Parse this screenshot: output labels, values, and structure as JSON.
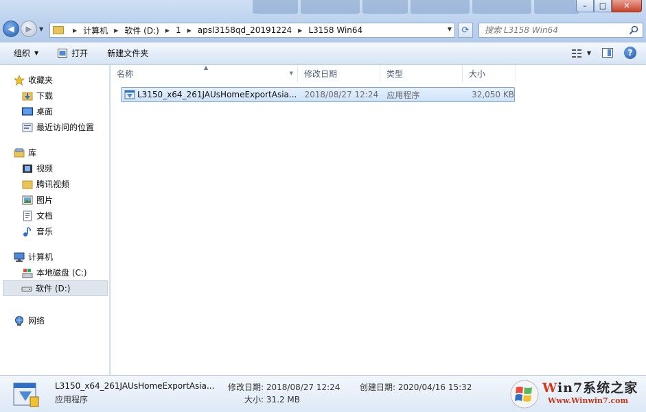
{
  "title_bar": {
    "buttons": {
      "minimize": "–",
      "maximize": "□",
      "close": "✕"
    }
  },
  "nav_buttons": {
    "back": "◀",
    "forward": "▶"
  },
  "address_bar": {
    "breadcrumbs": [
      "计算机",
      "软件 (D:)",
      "1",
      "apsl3158qd_20191224",
      "L3158 Win64"
    ]
  },
  "search": {
    "placeholder": "搜索 L3158 Win64"
  },
  "toolbar": {
    "organize_label": "组织",
    "open_label": "打开",
    "new_folder_label": "新建文件夹",
    "help_label": "?"
  },
  "sidebar": {
    "favorites": {
      "label": "收藏夹",
      "items": [
        "下载",
        "桌面",
        "最近访问的位置"
      ]
    },
    "libraries": {
      "label": "库",
      "items": [
        "视频",
        "腾讯视频",
        "图片",
        "文档",
        "音乐"
      ]
    },
    "computer": {
      "label": "计算机",
      "items": [
        "本地磁盘 (C:)",
        "软件 (D:)"
      ],
      "selected": "软件 (D:)"
    },
    "network": {
      "label": "网络"
    }
  },
  "columns": {
    "name": "名称",
    "date": "修改日期",
    "type": "类型",
    "size": "大小"
  },
  "files": [
    {
      "name": "L3150_x64_261JAUsHomeExportAsia...",
      "date": "2018/08/27 12:24",
      "type": "应用程序",
      "size": "32,050 KB"
    }
  ],
  "details": {
    "name": "L3150_x64_261JAUsHomeExportAsia...",
    "type": "应用程序",
    "modified": "修改日期: 2018/08/27 12:24",
    "size": "大小: 31.2 MB",
    "created": "创建日期: 2020/04/16 15:32"
  },
  "watermark": {
    "title_prefix": "W",
    "title_mid": "in7",
    "title_suffix": "系统之家",
    "url": "Www.Winwin7.com"
  },
  "colors": {
    "selection": "#cfe3fb",
    "accent": "#1e5fb4"
  }
}
